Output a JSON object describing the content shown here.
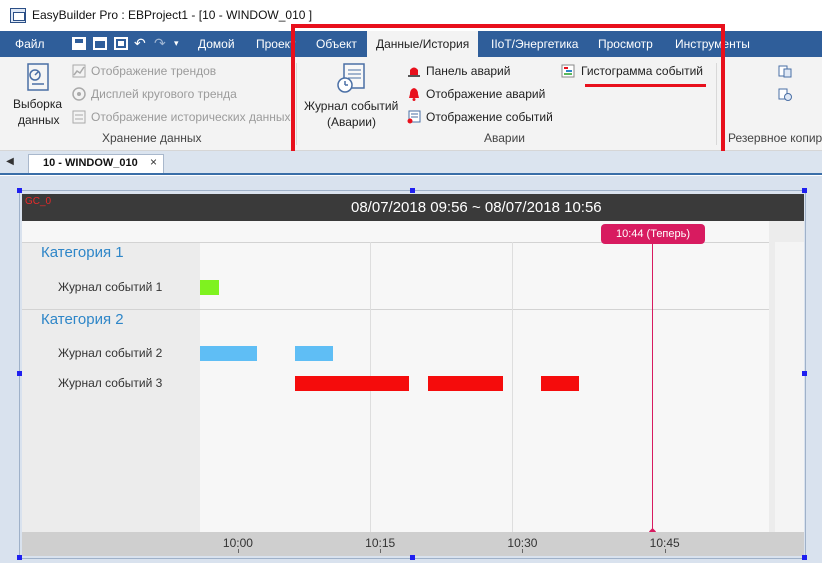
{
  "window": {
    "title": "EasyBuilder Pro : EBProject1 - [10 - WINDOW_010 ]"
  },
  "menu": {
    "file": "Файл",
    "quick_access_icons": [
      "save-icon",
      "open-folder-icon",
      "image-icon",
      "undo-icon",
      "redo-icon",
      "customize-icon"
    ],
    "tabs": [
      "Домой",
      "Проект",
      "Объект",
      "Данные/История",
      "IIoT/Энергетика",
      "Просмотр",
      "Инструменты"
    ],
    "active_tab": "Данные/История"
  },
  "ribbon": {
    "data_sampling_label": "Выборка данных",
    "data_sampling_line1": "Выборка",
    "data_sampling_line2": "данных",
    "trend_display": "Отображение трендов",
    "circular_trend": "Дисплей кругового тренда",
    "history_display": "Отображение исторических данных",
    "group_storage": "Хранение данных",
    "event_log_line1": "Журнал событий",
    "event_log_line2": "(Аварии)",
    "alarm_bar": "Панель аварий",
    "alarm_display": "Отображение аварий",
    "event_display": "Отображение событий",
    "event_histogram": "Гистограмма событий",
    "group_alarms": "Аварии",
    "backup_label": "Резервное копиро"
  },
  "document_tab": {
    "label": "10 - WINDOW_010",
    "close": "×"
  },
  "event_chart": {
    "object_id": "GC_0",
    "title": "08/07/2018 09:56 ~ 08/07/2018 10:56",
    "now_label": "10:44 (Теперь)",
    "categories": [
      {
        "name": "Категория 1",
        "rows": [
          "Журнал событий 1"
        ]
      },
      {
        "name": "Категория 2",
        "rows": [
          "Журнал событий 2",
          "Журнал событий 3"
        ]
      }
    ],
    "x_ticks": [
      "10:00",
      "10:15",
      "10:30",
      "10:45"
    ],
    "colors": {
      "log1": "#7ff21f",
      "log2": "#5fbef5",
      "log3": "#f50c0c",
      "now": "#d81b60",
      "category": "#2e86c8",
      "highlight": "#e8101c"
    }
  },
  "chart_data": {
    "type": "bar",
    "title": "08/07/2018 09:56 ~ 08/07/2018 10:56",
    "x_range": [
      "09:56",
      "10:56"
    ],
    "x_ticks": [
      "10:00",
      "10:15",
      "10:30",
      "10:45"
    ],
    "now": "10:44",
    "series": [
      {
        "name": "Журнал событий 1",
        "category": "Категория 1",
        "intervals": [
          [
            "09:56",
            "09:58"
          ]
        ]
      },
      {
        "name": "Журнал событий 2",
        "category": "Категория 2",
        "intervals": [
          [
            "09:56",
            "10:02"
          ],
          [
            "10:06",
            "10:10"
          ]
        ]
      },
      {
        "name": "Журнал событий 3",
        "category": "Категория 2",
        "intervals": [
          [
            "10:06",
            "10:18"
          ],
          [
            "10:20",
            "10:28"
          ],
          [
            "10:32",
            "10:36"
          ]
        ]
      }
    ]
  }
}
